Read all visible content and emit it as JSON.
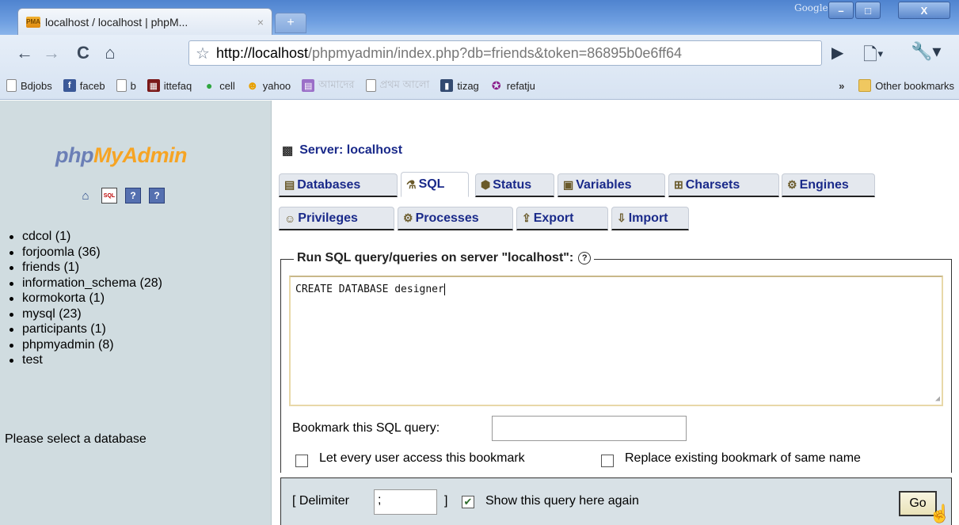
{
  "browser": {
    "tab_title": "localhost / localhost | phpM...",
    "tab_close": "×",
    "new_tab": "+",
    "window_brand": "Google",
    "window_buttons": {
      "minimize": "–",
      "maximize": "□",
      "close": "X"
    },
    "url_host": "http://localhost",
    "url_path": "/phpmyadmin/index.php?db=friends&token=86895b0e6ff64",
    "bookmarks": [
      {
        "label": "Bdjobs",
        "icon": "page-icon"
      },
      {
        "label": "faceb",
        "icon": "facebook-icon"
      },
      {
        "label": "b",
        "icon": "page-icon"
      },
      {
        "label": "ittefaq",
        "icon": "ittefaq-icon"
      },
      {
        "label": "cell",
        "icon": "green-dot-icon"
      },
      {
        "label": "yahoo",
        "icon": "yahoo-smiley-icon"
      },
      {
        "label": "আমাদের",
        "icon": "purple-icon"
      },
      {
        "label": "প্রথম আলো",
        "icon": "page-icon"
      },
      {
        "label": "tizag",
        "icon": "tizag-icon"
      },
      {
        "label": "refatju",
        "icon": "refatju-icon"
      }
    ],
    "bookmarks_more": "»",
    "other_bookmarks": "Other bookmarks"
  },
  "sidebar": {
    "logo_php": "php",
    "logo_my": "My",
    "logo_admin": "Admin",
    "databases": [
      "cdcol (1)",
      "forjoomla (36)",
      "friends (1)",
      "information_schema (28)",
      "kormokorta (1)",
      "mysql (23)",
      "participants (1)",
      "phpmyadmin (8)",
      "test"
    ],
    "hint": "Please select a database"
  },
  "main": {
    "server_title": "Server: localhost",
    "tabs": [
      {
        "label": "Databases"
      },
      {
        "label": "SQL"
      },
      {
        "label": "Status"
      },
      {
        "label": "Variables"
      },
      {
        "label": "Charsets"
      },
      {
        "label": "Engines"
      },
      {
        "label": "Privileges"
      },
      {
        "label": "Processes"
      },
      {
        "label": "Export"
      },
      {
        "label": "Import"
      }
    ],
    "sql_legend": "Run SQL query/queries on server \"localhost\":",
    "help": "?",
    "query": "CREATE DATABASE designer",
    "bookmark_label": "Bookmark this SQL query:",
    "share_label": "Let every user access this bookmark",
    "replace_label": "Replace existing bookmark of same name",
    "delimiter_open": "[ Delimiter",
    "delimiter_value": ";",
    "delimiter_close": "]",
    "show_again_label": "Show this query here again",
    "go_label": "Go"
  },
  "colors": {
    "titlebar": "#5b8dd6",
    "left_pane": "#d0dce0",
    "tab_text": "#1a2a8a",
    "logo_orange": "#f6a424"
  }
}
